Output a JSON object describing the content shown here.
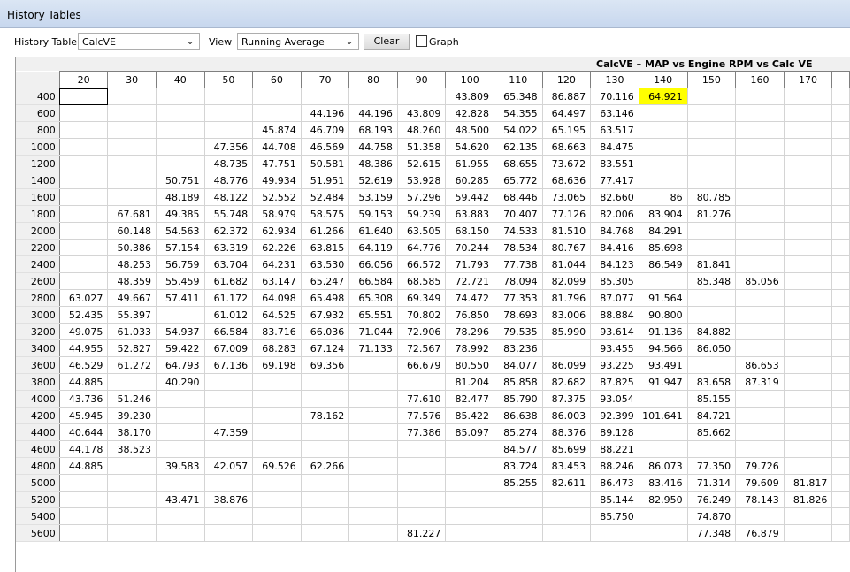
{
  "window": {
    "title": "History Tables"
  },
  "toolbar": {
    "history_table_label": "History Table",
    "history_table_value": "CalcVE",
    "view_label": "View",
    "view_value": "Running Average",
    "clear_label": "Clear",
    "graph_label": "Graph",
    "graph_checked": false
  },
  "grid": {
    "caption": "CalcVE – MAP vs Engine RPM vs Calc VE",
    "columns": [
      "20",
      "30",
      "40",
      "50",
      "60",
      "70",
      "80",
      "90",
      "100",
      "110",
      "120",
      "130",
      "140",
      "150",
      "160",
      "170"
    ],
    "highlight_color": "#ffff00",
    "highlight": {
      "row": 0,
      "col": 12
    },
    "selected": {
      "row": 0,
      "col": 0
    },
    "rows": [
      {
        "label": "400",
        "cells": [
          "",
          "",
          "",
          "",
          "",
          "",
          "",
          "",
          "43.809",
          "65.348",
          "86.887",
          "70.116",
          "64.921",
          "",
          "",
          ""
        ]
      },
      {
        "label": "600",
        "cells": [
          "",
          "",
          "",
          "",
          "",
          "44.196",
          "44.196",
          "43.809",
          "42.828",
          "54.355",
          "64.497",
          "63.146",
          "",
          "",
          "",
          ""
        ]
      },
      {
        "label": "800",
        "cells": [
          "",
          "",
          "",
          "",
          "45.874",
          "46.709",
          "68.193",
          "48.260",
          "48.500",
          "54.022",
          "65.195",
          "63.517",
          "",
          "",
          "",
          ""
        ]
      },
      {
        "label": "1000",
        "cells": [
          "",
          "",
          "",
          "47.356",
          "44.708",
          "46.569",
          "44.758",
          "51.358",
          "54.620",
          "62.135",
          "68.663",
          "84.475",
          "",
          "",
          "",
          ""
        ]
      },
      {
        "label": "1200",
        "cells": [
          "",
          "",
          "",
          "48.735",
          "47.751",
          "50.581",
          "48.386",
          "52.615",
          "61.955",
          "68.655",
          "73.672",
          "83.551",
          "",
          "",
          "",
          ""
        ]
      },
      {
        "label": "1400",
        "cells": [
          "",
          "",
          "50.751",
          "48.776",
          "49.934",
          "51.951",
          "52.619",
          "53.928",
          "60.285",
          "65.772",
          "68.636",
          "77.417",
          "",
          "",
          "",
          ""
        ]
      },
      {
        "label": "1600",
        "cells": [
          "",
          "",
          "48.189",
          "48.122",
          "52.552",
          "52.484",
          "53.159",
          "57.296",
          "59.442",
          "68.446",
          "73.065",
          "82.660",
          "86",
          "80.785",
          "",
          ""
        ]
      },
      {
        "label": "1800",
        "cells": [
          "",
          "67.681",
          "49.385",
          "55.748",
          "58.979",
          "58.575",
          "59.153",
          "59.239",
          "63.883",
          "70.407",
          "77.126",
          "82.006",
          "83.904",
          "81.276",
          "",
          ""
        ]
      },
      {
        "label": "2000",
        "cells": [
          "",
          "60.148",
          "54.563",
          "62.372",
          "62.934",
          "61.266",
          "61.640",
          "63.505",
          "68.150",
          "74.533",
          "81.510",
          "84.768",
          "84.291",
          "",
          "",
          ""
        ]
      },
      {
        "label": "2200",
        "cells": [
          "",
          "50.386",
          "57.154",
          "63.319",
          "62.226",
          "63.815",
          "64.119",
          "64.776",
          "70.244",
          "78.534",
          "80.767",
          "84.416",
          "85.698",
          "",
          "",
          ""
        ]
      },
      {
        "label": "2400",
        "cells": [
          "",
          "48.253",
          "56.759",
          "63.704",
          "64.231",
          "63.530",
          "66.056",
          "66.572",
          "71.793",
          "77.738",
          "81.044",
          "84.123",
          "86.549",
          "81.841",
          "",
          ""
        ]
      },
      {
        "label": "2600",
        "cells": [
          "",
          "48.359",
          "55.459",
          "61.682",
          "63.147",
          "65.247",
          "66.584",
          "68.585",
          "72.721",
          "78.094",
          "82.099",
          "85.305",
          "",
          "85.348",
          "85.056",
          ""
        ]
      },
      {
        "label": "2800",
        "cells": [
          "63.027",
          "49.667",
          "57.411",
          "61.172",
          "64.098",
          "65.498",
          "65.308",
          "69.349",
          "74.472",
          "77.353",
          "81.796",
          "87.077",
          "91.564",
          "",
          "",
          ""
        ]
      },
      {
        "label": "3000",
        "cells": [
          "52.435",
          "55.397",
          "",
          "61.012",
          "64.525",
          "67.932",
          "65.551",
          "70.802",
          "76.850",
          "78.693",
          "83.006",
          "88.884",
          "90.800",
          "",
          "",
          ""
        ]
      },
      {
        "label": "3200",
        "cells": [
          "49.075",
          "61.033",
          "54.937",
          "66.584",
          "83.716",
          "66.036",
          "71.044",
          "72.906",
          "78.296",
          "79.535",
          "85.990",
          "93.614",
          "91.136",
          "84.882",
          "",
          ""
        ]
      },
      {
        "label": "3400",
        "cells": [
          "44.955",
          "52.827",
          "59.422",
          "67.009",
          "68.283",
          "67.124",
          "71.133",
          "72.567",
          "78.992",
          "83.236",
          "",
          "93.455",
          "94.566",
          "86.050",
          "",
          ""
        ]
      },
      {
        "label": "3600",
        "cells": [
          "46.529",
          "61.272",
          "64.793",
          "67.136",
          "69.198",
          "69.356",
          "",
          "66.679",
          "80.550",
          "84.077",
          "86.099",
          "93.225",
          "93.491",
          "",
          "86.653",
          ""
        ]
      },
      {
        "label": "3800",
        "cells": [
          "44.885",
          "",
          "40.290",
          "",
          "",
          "",
          "",
          "",
          "81.204",
          "85.858",
          "82.682",
          "87.825",
          "91.947",
          "83.658",
          "87.319",
          ""
        ]
      },
      {
        "label": "4000",
        "cells": [
          "43.736",
          "51.246",
          "",
          "",
          "",
          "",
          "",
          "77.610",
          "82.477",
          "85.790",
          "87.375",
          "93.054",
          "",
          "85.155",
          "",
          ""
        ]
      },
      {
        "label": "4200",
        "cells": [
          "45.945",
          "39.230",
          "",
          "",
          "",
          "78.162",
          "",
          "77.576",
          "85.422",
          "86.638",
          "86.003",
          "92.399",
          "101.641",
          "84.721",
          "",
          ""
        ]
      },
      {
        "label": "4400",
        "cells": [
          "40.644",
          "38.170",
          "",
          "47.359",
          "",
          "",
          "",
          "77.386",
          "85.097",
          "85.274",
          "88.376",
          "89.128",
          "",
          "85.662",
          "",
          ""
        ]
      },
      {
        "label": "4600",
        "cells": [
          "44.178",
          "38.523",
          "",
          "",
          "",
          "",
          "",
          "",
          "",
          "84.577",
          "85.699",
          "88.221",
          "",
          "",
          "",
          ""
        ]
      },
      {
        "label": "4800",
        "cells": [
          "44.885",
          "",
          "39.583",
          "42.057",
          "69.526",
          "62.266",
          "",
          "",
          "",
          "83.724",
          "83.453",
          "88.246",
          "86.073",
          "77.350",
          "79.726",
          ""
        ]
      },
      {
        "label": "5000",
        "cells": [
          "",
          "",
          "",
          "",
          "",
          "",
          "",
          "",
          "",
          "85.255",
          "82.611",
          "86.473",
          "83.416",
          "71.314",
          "79.609",
          "81.817"
        ]
      },
      {
        "label": "5200",
        "cells": [
          "",
          "",
          "43.471",
          "38.876",
          "",
          "",
          "",
          "",
          "",
          "",
          "",
          "85.144",
          "82.950",
          "76.249",
          "78.143",
          "81.826"
        ]
      },
      {
        "label": "5400",
        "cells": [
          "",
          "",
          "",
          "",
          "",
          "",
          "",
          "",
          "",
          "",
          "",
          "85.750",
          "",
          "74.870",
          "",
          ""
        ]
      },
      {
        "label": "5600",
        "cells": [
          "",
          "",
          "",
          "",
          "",
          "",
          "",
          "81.227",
          "",
          "",
          "",
          "",
          "",
          "77.348",
          "76.879",
          ""
        ]
      }
    ]
  }
}
